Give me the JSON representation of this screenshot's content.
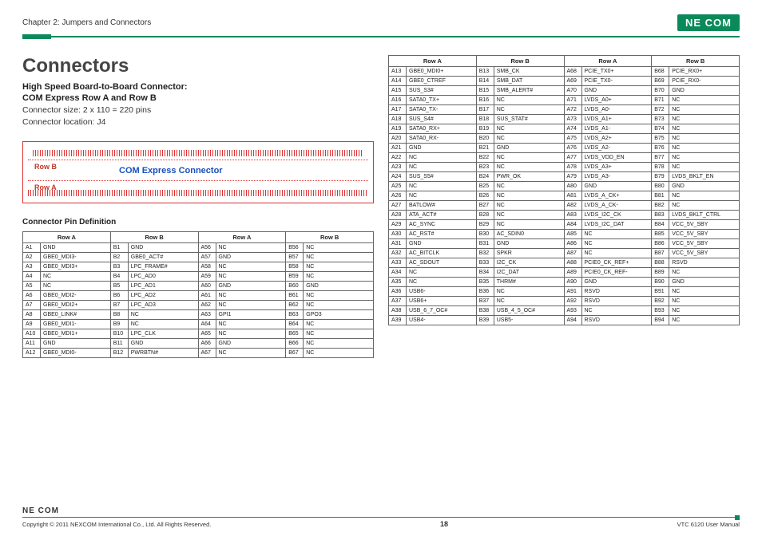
{
  "header": {
    "chapter": "Chapter 2: Jumpers and Connectors",
    "logo": "NE COM"
  },
  "title": "Connectors",
  "subtitle1": "High Speed Board-to-Board Connector:",
  "subtitle2": "COM Express Row A and Row B",
  "info1": "Connector size: 2 x 110 = 220 pins",
  "info2": "Connector location: J4",
  "diagram": {
    "rowB": "Row B",
    "rowA": "Row A",
    "title": "COM Express Connector"
  },
  "cpd": "Connector Pin Definition",
  "tableHeaders": [
    "Row A",
    "Row B",
    "Row A",
    "Row B"
  ],
  "leftTable": {
    "rows": [
      [
        "A1",
        "GND",
        "B1",
        "GND",
        "A56",
        "NC",
        "B56",
        "NC"
      ],
      [
        "A2",
        "GBE0_MDI3-",
        "B2",
        "GBE0_ACT#",
        "A57",
        "GND",
        "B57",
        "NC"
      ],
      [
        "A3",
        "GBE0_MDI3+",
        "B3",
        "LPC_FRAME#",
        "A58",
        "NC",
        "B58",
        "NC"
      ],
      [
        "A4",
        "NC",
        "B4",
        "LPC_AD0",
        "A59",
        "NC",
        "B59",
        "NC"
      ],
      [
        "A5",
        "NC",
        "B5",
        "LPC_AD1",
        "A60",
        "GND",
        "B60",
        "GND"
      ],
      [
        "A6",
        "GBE0_MDI2-",
        "B6",
        "LPC_AD2",
        "A61",
        "NC",
        "B61",
        "NC"
      ],
      [
        "A7",
        "GBE0_MDI2+",
        "B7",
        "LPC_AD3",
        "A62",
        "NC",
        "B62",
        "NC"
      ],
      [
        "A8",
        "GBE0_LINK#",
        "B8",
        "NC",
        "A63",
        "GPI1",
        "B63",
        "GPO3"
      ],
      [
        "A9",
        "GBE0_MDI1-",
        "B9",
        "NC",
        "A64",
        "NC",
        "B64",
        "NC"
      ],
      [
        "A10",
        "GBE0_MDI1+",
        "B10",
        "LPC_CLK",
        "A65",
        "NC",
        "B65",
        "NC"
      ],
      [
        "A11",
        "GND",
        "B11",
        "GND",
        "A66",
        "GND",
        "B66",
        "NC"
      ],
      [
        "A12",
        "GBE0_MDI0-",
        "B12",
        "PWRBTN#",
        "A67",
        "NC",
        "B67",
        "NC"
      ]
    ]
  },
  "rightTable": {
    "rows": [
      [
        "A13",
        "GBE0_MDI0+",
        "B13",
        "SMB_CK",
        "A68",
        "PCIE_TX0+",
        "B68",
        "PCIE_RX0+"
      ],
      [
        "A14",
        "GBE0_CTREF",
        "B14",
        "SMB_DAT",
        "A69",
        "PCIE_TX0-",
        "B69",
        "PCIE_RX0-"
      ],
      [
        "A15",
        "SUS_S3#",
        "B15",
        "SMB_ALERT#",
        "A70",
        "GND",
        "B70",
        "GND"
      ],
      [
        "A16",
        "SATA0_TX+",
        "B16",
        "NC",
        "A71",
        "LVDS_A0+",
        "B71",
        "NC"
      ],
      [
        "A17",
        "SATA0_TX-",
        "B17",
        "NC",
        "A72",
        "LVDS_A0-",
        "B72",
        "NC"
      ],
      [
        "A18",
        "SUS_S4#",
        "B18",
        "SUS_STAT#",
        "A73",
        "LVDS_A1+",
        "B73",
        "NC"
      ],
      [
        "A19",
        "SATA0_RX+",
        "B19",
        "NC",
        "A74",
        "LVDS_A1-",
        "B74",
        "NC"
      ],
      [
        "A20",
        "SATA0_RX-",
        "B20",
        "NC",
        "A75",
        "LVDS_A2+",
        "B75",
        "NC"
      ],
      [
        "A21",
        "GND",
        "B21",
        "GND",
        "A76",
        "LVDS_A2-",
        "B76",
        "NC"
      ],
      [
        "A22",
        "NC",
        "B22",
        "NC",
        "A77",
        "LVDS_VDD_EN",
        "B77",
        "NC"
      ],
      [
        "A23",
        "NC",
        "B23",
        "NC",
        "A78",
        "LVDS_A3+",
        "B78",
        "NC"
      ],
      [
        "A24",
        "SUS_S5#",
        "B24",
        "PWR_OK",
        "A79",
        "LVDS_A3-",
        "B79",
        "LVDS_BKLT_EN"
      ],
      [
        "A25",
        "NC",
        "B25",
        "NC",
        "A80",
        "GND",
        "B80",
        "GND"
      ],
      [
        "A26",
        "NC",
        "B26",
        "NC",
        "A81",
        "LVDS_A_CK+",
        "B81",
        "NC"
      ],
      [
        "A27",
        "BATLOW#",
        "B27",
        "NC",
        "A82",
        "LVDS_A_CK-",
        "B82",
        "NC"
      ],
      [
        "A28",
        "ATA_ACT#",
        "B28",
        "NC",
        "A83",
        "LVDS_I2C_CK",
        "B83",
        "LVDS_BKLT_CTRL"
      ],
      [
        "A29",
        "AC_SYNC",
        "B29",
        "NC",
        "A84",
        "LVDS_I2C_DAT",
        "B84",
        "VCC_5V_SBY"
      ],
      [
        "A30",
        "AC_RST#",
        "B30",
        "AC_SDIN0",
        "A85",
        "NC",
        "B85",
        "VCC_5V_SBY"
      ],
      [
        "A31",
        "GND",
        "B31",
        "GND",
        "A86",
        "NC",
        "B86",
        "VCC_5V_SBY"
      ],
      [
        "A32",
        "AC_BITCLK",
        "B32",
        "SPKR",
        "A87",
        "NC",
        "B87",
        "VCC_5V_SBY"
      ],
      [
        "A33",
        "AC_SDOUT",
        "B33",
        "I2C_CK",
        "A88",
        "PCIE0_CK_REF+",
        "B88",
        "RSVD"
      ],
      [
        "A34",
        "NC",
        "B34",
        "I2C_DAT",
        "A89",
        "PCIE0_CK_REF-",
        "B89",
        "NC"
      ],
      [
        "A35",
        "NC",
        "B35",
        "THRM#",
        "A90",
        "GND",
        "B90",
        "GND"
      ],
      [
        "A36",
        "USB6-",
        "B36",
        "NC",
        "A91",
        "RSVD",
        "B91",
        "NC"
      ],
      [
        "A37",
        "USB6+",
        "B37",
        "NC",
        "A92",
        "RSVD",
        "B92",
        "NC"
      ],
      [
        "A38",
        "USB_6_7_OC#",
        "B38",
        "USB_4_5_OC#",
        "A93",
        "NC",
        "B93",
        "NC"
      ],
      [
        "A39",
        "USB4-",
        "B39",
        "USB5-",
        "A94",
        "RSVD",
        "B94",
        "NC"
      ]
    ]
  },
  "footer": {
    "logo": "NE COM",
    "copyright": "Copyright © 2011 NEXCOM International Co., Ltd. All Rights Reserved.",
    "page": "18",
    "manual": "VTC 6120 User Manual"
  }
}
